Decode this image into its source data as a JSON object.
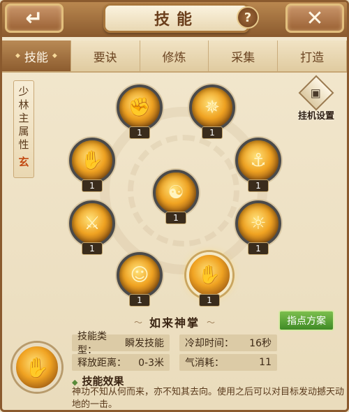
{
  "header": {
    "title": "技能",
    "back_icon": "back-arrow-icon",
    "close_icon": "close-icon",
    "help_label": "?"
  },
  "tabs": [
    {
      "label": "技能",
      "active": true
    },
    {
      "label": "要诀",
      "active": false
    },
    {
      "label": "修炼",
      "active": false
    },
    {
      "label": "采集",
      "active": false
    },
    {
      "label": "打造",
      "active": false
    }
  ],
  "attribute": {
    "chars": [
      "少",
      "林",
      "主",
      "属",
      "性"
    ],
    "element": "玄"
  },
  "idle_settings": {
    "label": "挂机设置",
    "icon": "monitor-icon"
  },
  "skills": [
    {
      "id": "top-left",
      "level": "1",
      "icon": "fist-strike-icon"
    },
    {
      "id": "top-right",
      "level": "1",
      "icon": "golden-blast-icon"
    },
    {
      "id": "left-upper",
      "level": "1",
      "icon": "golden-palm-icon"
    },
    {
      "id": "right-upper",
      "level": "1",
      "icon": "kick-stance-icon"
    },
    {
      "id": "center",
      "level": "1",
      "icon": "swirl-sigil-icon"
    },
    {
      "id": "left-lower",
      "level": "1",
      "icon": "monk-staff-icon"
    },
    {
      "id": "right-lower",
      "level": "1",
      "icon": "lion-roar-icon"
    },
    {
      "id": "bottom-left",
      "level": "1",
      "icon": "golden-body-icon"
    },
    {
      "id": "bottom-right",
      "level": "1",
      "icon": "claw-palm-icon",
      "selected": true
    }
  ],
  "detail": {
    "name": "如来神掌",
    "plan_button": "指点方案",
    "skill_type_label": "技能类型：",
    "skill_type_value": "瞬发技能",
    "cooldown_label": "冷却时间：",
    "cooldown_value": "16秒",
    "range_label": "释放距离：",
    "range_value": "0-3米",
    "qi_label": "气消耗：",
    "qi_value": "11",
    "effect_title": "技能效果",
    "effect_text": "神功不知从何而来，亦不知其去向。使用之后可以对目标发动撼天动地的一击。"
  },
  "colors": {
    "accent_brown": "#8a5a2e",
    "tab_active": "#b98a55",
    "plan_button_green": "#4f9a30",
    "element_color": "#c24a12"
  }
}
